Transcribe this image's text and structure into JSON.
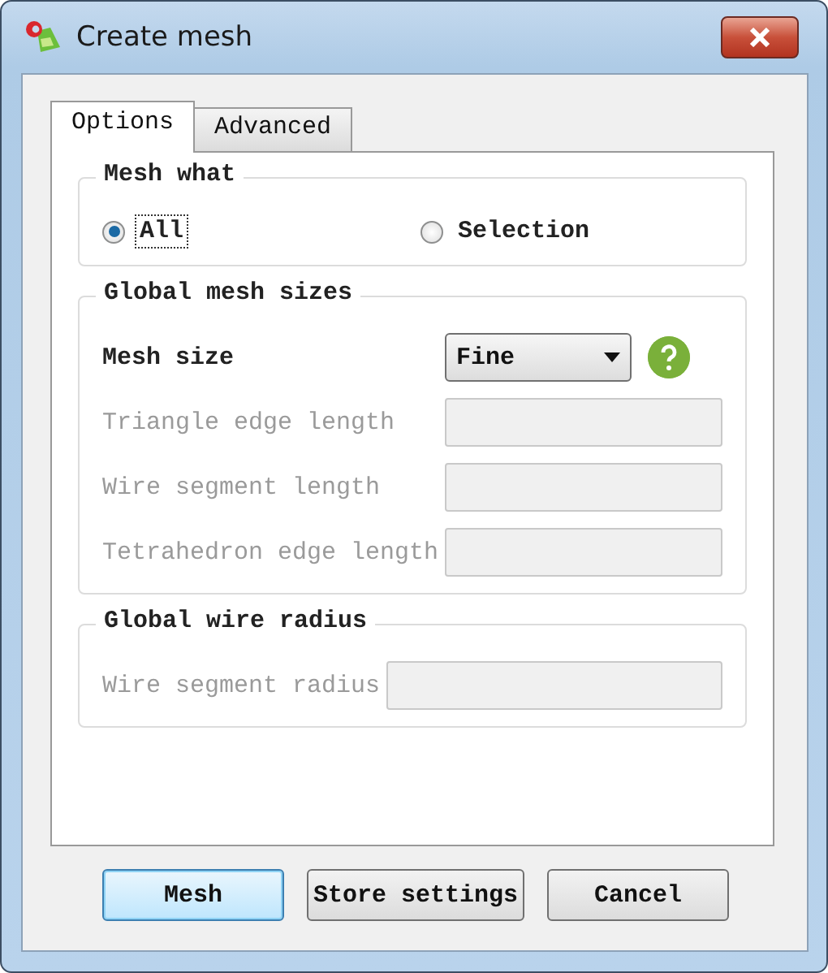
{
  "window": {
    "title": "Create mesh"
  },
  "tabs": [
    {
      "label": "Options",
      "selected": true
    },
    {
      "label": "Advanced",
      "selected": false
    }
  ],
  "groups": [
    {
      "title": "Mesh what",
      "rows": [
        {
          "kind": "radios",
          "options": [
            {
              "label": "All",
              "selected": true,
              "focused": true
            },
            {
              "label": "Selection",
              "selected": false,
              "focused": false
            }
          ]
        }
      ]
    },
    {
      "title": "Global mesh sizes",
      "rows": [
        {
          "kind": "select",
          "label": "Mesh size",
          "value": "Fine",
          "disabled": false,
          "help": true
        },
        {
          "kind": "field",
          "label": "Triangle edge length",
          "disabled": true
        },
        {
          "kind": "field",
          "label": "Wire segment length",
          "disabled": true
        },
        {
          "kind": "field",
          "label": "Tetrahedron edge length",
          "disabled": true
        }
      ]
    },
    {
      "title": "Global wire radius",
      "rows": [
        {
          "kind": "field",
          "label": "Wire segment radius",
          "disabled": true
        }
      ]
    }
  ],
  "buttons": [
    {
      "label": "Mesh",
      "default": true
    },
    {
      "label": "Store settings",
      "default": false
    },
    {
      "label": "Cancel",
      "default": false
    }
  ]
}
